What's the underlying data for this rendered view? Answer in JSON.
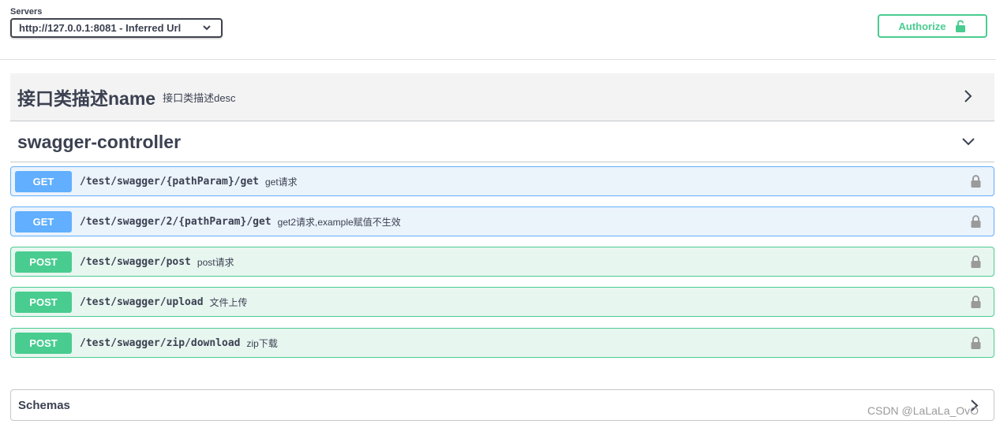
{
  "topbar": {
    "servers_label": "Servers",
    "server_selected": "http://127.0.0.1:8081 - Inferred Url",
    "authorize_label": "Authorize"
  },
  "tags": [
    {
      "name": "接口类描述name",
      "description": "接口类描述desc",
      "state": "collapsed"
    },
    {
      "name": "swagger-controller",
      "state": "expanded"
    }
  ],
  "operations": [
    {
      "method": "GET",
      "path": "/test/swagger/{pathParam}/get",
      "summary": "get请求"
    },
    {
      "method": "GET",
      "path": "/test/swagger/2/{pathParam}/get",
      "summary": "get2请求,example赋值不生效"
    },
    {
      "method": "POST",
      "path": "/test/swagger/post",
      "summary": "post请求"
    },
    {
      "method": "POST",
      "path": "/test/swagger/upload",
      "summary": "文件上传"
    },
    {
      "method": "POST",
      "path": "/test/swagger/zip/download",
      "summary": "zip下载"
    }
  ],
  "schemas": {
    "label": "Schemas"
  },
  "watermark": "CSDN @LaLaLa_OvO",
  "colors": {
    "get": "#61affe",
    "post": "#49cc90",
    "text": "#3b4151"
  },
  "icons": [
    "chevron-down-icon",
    "lock-icon",
    "unlock-icon",
    "chevron-right-icon"
  ]
}
